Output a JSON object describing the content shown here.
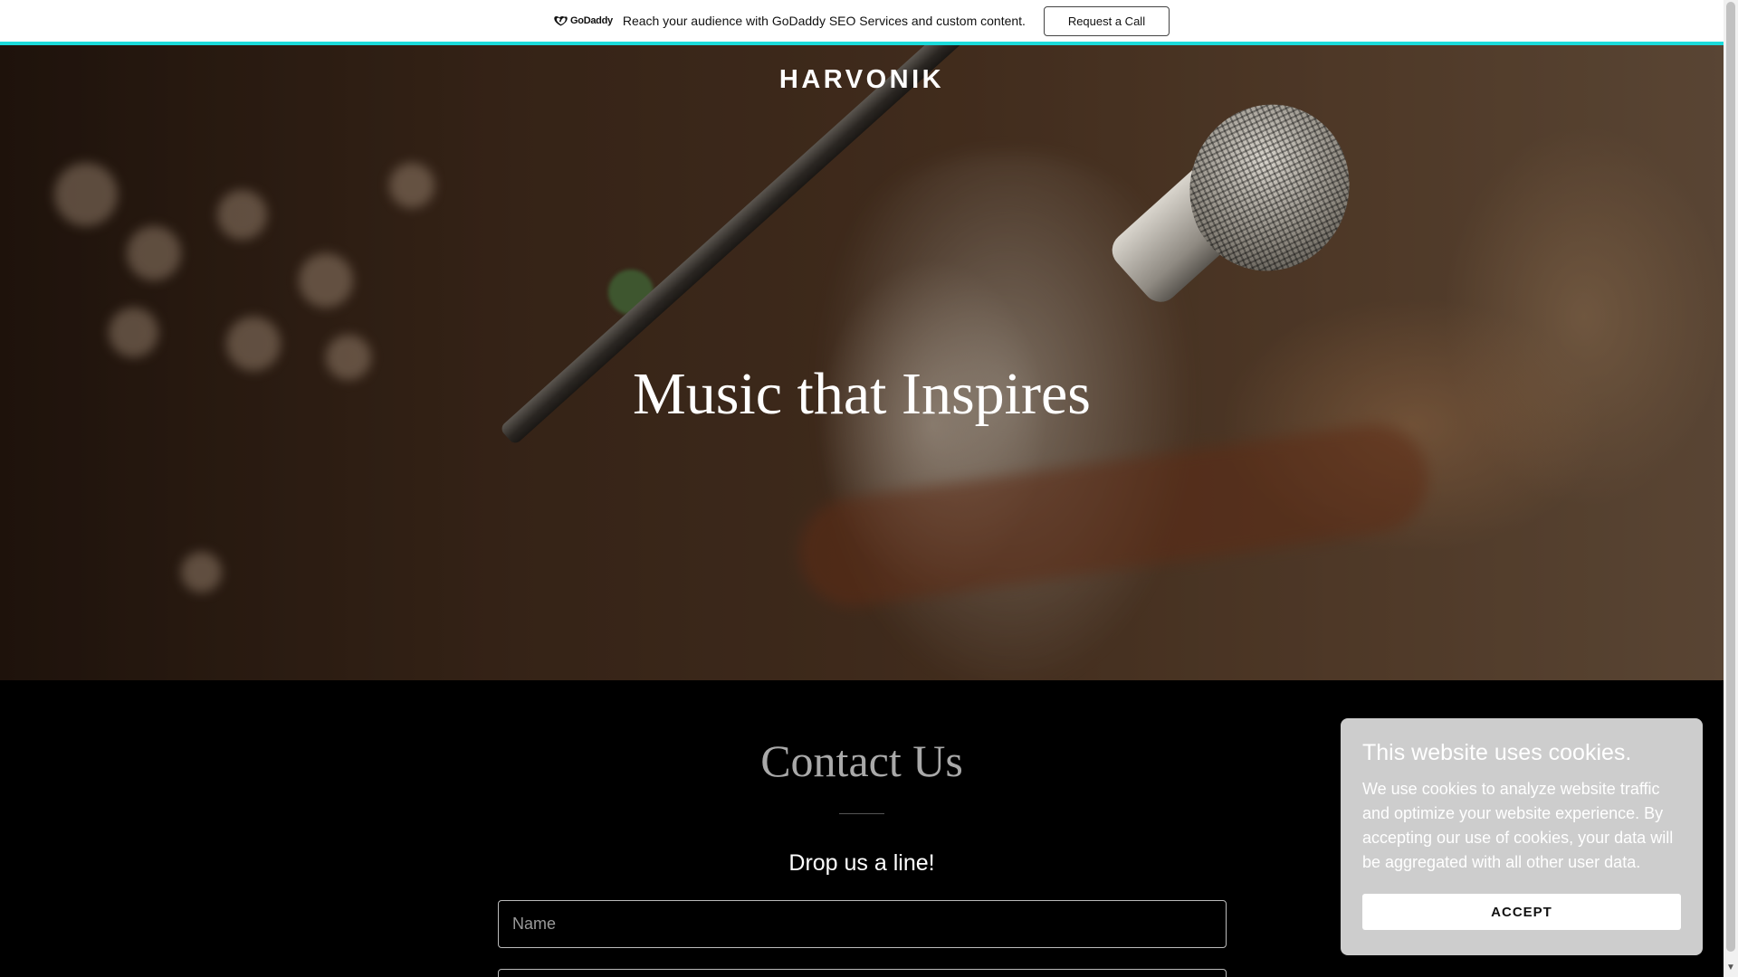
{
  "promo": {
    "logo_text": "GoDaddy",
    "message": "Reach your audience with GoDaddy SEO Services and custom content.",
    "cta_label": "Request a Call"
  },
  "hero": {
    "brand": "HARVONIK",
    "headline": "Music that Inspires"
  },
  "contact": {
    "title": "Contact Us",
    "subtitle": "Drop us a line!",
    "name_placeholder": "Name",
    "email_placeholder": ""
  },
  "cookie": {
    "title": "This website uses cookies.",
    "body": "We use cookies to analyze website traffic and optimize your website experience. By accepting our use of cookies, your data will be aggregated with all other user data.",
    "accept_label": "ACCEPT"
  },
  "colors": {
    "accent_line": "#1bdbdb",
    "cookie_bg": "#cdcdcd",
    "section_bg": "#000000"
  },
  "icons": {
    "logo": "godaddy-logo-icon",
    "scroll_down": "chevron-down-icon"
  }
}
